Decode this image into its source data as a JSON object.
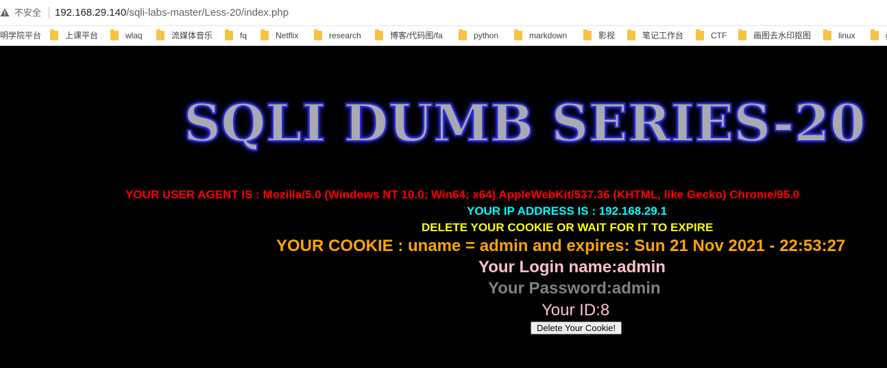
{
  "browser": {
    "security_label": "不安全",
    "url_host": "192.168.29.140",
    "url_path": "/sqli-labs-master/Less-20/index.php"
  },
  "bookmarks": [
    {
      "label": "明学院平台",
      "icon": "none"
    },
    {
      "label": "上课平台",
      "icon": "folder-icon"
    },
    {
      "label": "wlaq",
      "icon": "folder-icon"
    },
    {
      "label": "流媒体音乐",
      "icon": "folder-icon"
    },
    {
      "label": "fq",
      "icon": "folder-icon"
    },
    {
      "label": "Netflix",
      "icon": "folder-icon"
    },
    {
      "label": "research",
      "icon": "folder-icon"
    },
    {
      "label": "博客/代码图/fa",
      "icon": "folder-icon"
    },
    {
      "label": "python",
      "icon": "folder-icon"
    },
    {
      "label": "markdown",
      "icon": "folder-icon"
    },
    {
      "label": "影视",
      "icon": "folder-icon"
    },
    {
      "label": "笔记工作台",
      "icon": "folder-icon"
    },
    {
      "label": "CTF",
      "icon": "folder-icon"
    },
    {
      "label": "画图去水印抠图",
      "icon": "folder-icon"
    },
    {
      "label": "linux",
      "icon": "folder-icon"
    },
    {
      "label": "g",
      "icon": "folder-icon"
    }
  ],
  "page": {
    "banner": "SQLI DUMB SERIES-20",
    "user_agent": "YOUR USER AGENT IS : Mozilla/5.0 (Windows NT 10.0; Win64; x64) AppleWebKit/537.36 (KHTML, like Gecko) Chrome/95.0",
    "ip_address": "YOUR IP ADDRESS IS : 192.168.29.1",
    "delete_notice": "DELETE YOUR COOKIE OR WAIT FOR IT TO EXPIRE",
    "cookie": "YOUR COOKIE : uname = admin and expires: Sun 21 Nov 2021 - 22:53:27",
    "login_name": "Your Login name:admin",
    "password": "Your Password:admin",
    "id": "Your ID:8",
    "delete_button": "Delete Your Cookie!"
  },
  "colors": {
    "user_agent": "#ff0000",
    "ip_address": "#00ffff",
    "delete_notice": "#ffff00",
    "cookie": "#ffa500",
    "login_name": "#ffc0cb",
    "password": "#808080",
    "id": "#ffc0cb"
  }
}
